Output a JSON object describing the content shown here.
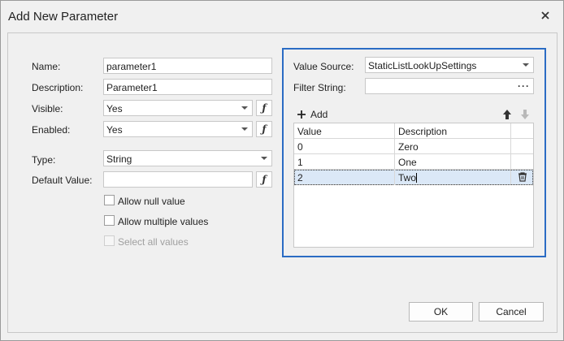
{
  "dialog": {
    "title": "Add New Parameter"
  },
  "left": {
    "name_label": "Name:",
    "name_value": "parameter1",
    "description_label": "Description:",
    "description_value": "Parameter1",
    "visible_label": "Visible:",
    "visible_value": "Yes",
    "enabled_label": "Enabled:",
    "enabled_value": "Yes",
    "type_label": "Type:",
    "type_value": "String",
    "default_label": "Default Value:",
    "default_value": "",
    "allow_null_label": "Allow null value",
    "allow_null_checked": false,
    "allow_multiple_label": "Allow multiple values",
    "allow_multiple_checked": false,
    "select_all_label": "Select all values",
    "select_all_checked": false,
    "select_all_disabled": true
  },
  "right": {
    "value_source_label": "Value Source:",
    "value_source_value": "StaticListLookUpSettings",
    "filter_label": "Filter String:",
    "filter_value": "",
    "filter_button": "···",
    "add_label": "Add",
    "grid": {
      "columns": [
        "Value",
        "Description"
      ],
      "rows": [
        {
          "value": "0",
          "description": "Zero"
        },
        {
          "value": "1",
          "description": "One"
        },
        {
          "value": "2",
          "description": "Two"
        }
      ],
      "selected_index": 2
    }
  },
  "footer": {
    "ok_label": "OK",
    "cancel_label": "Cancel"
  },
  "colors": {
    "accent": "#2b6cc4",
    "selection": "#dbe8f7"
  }
}
